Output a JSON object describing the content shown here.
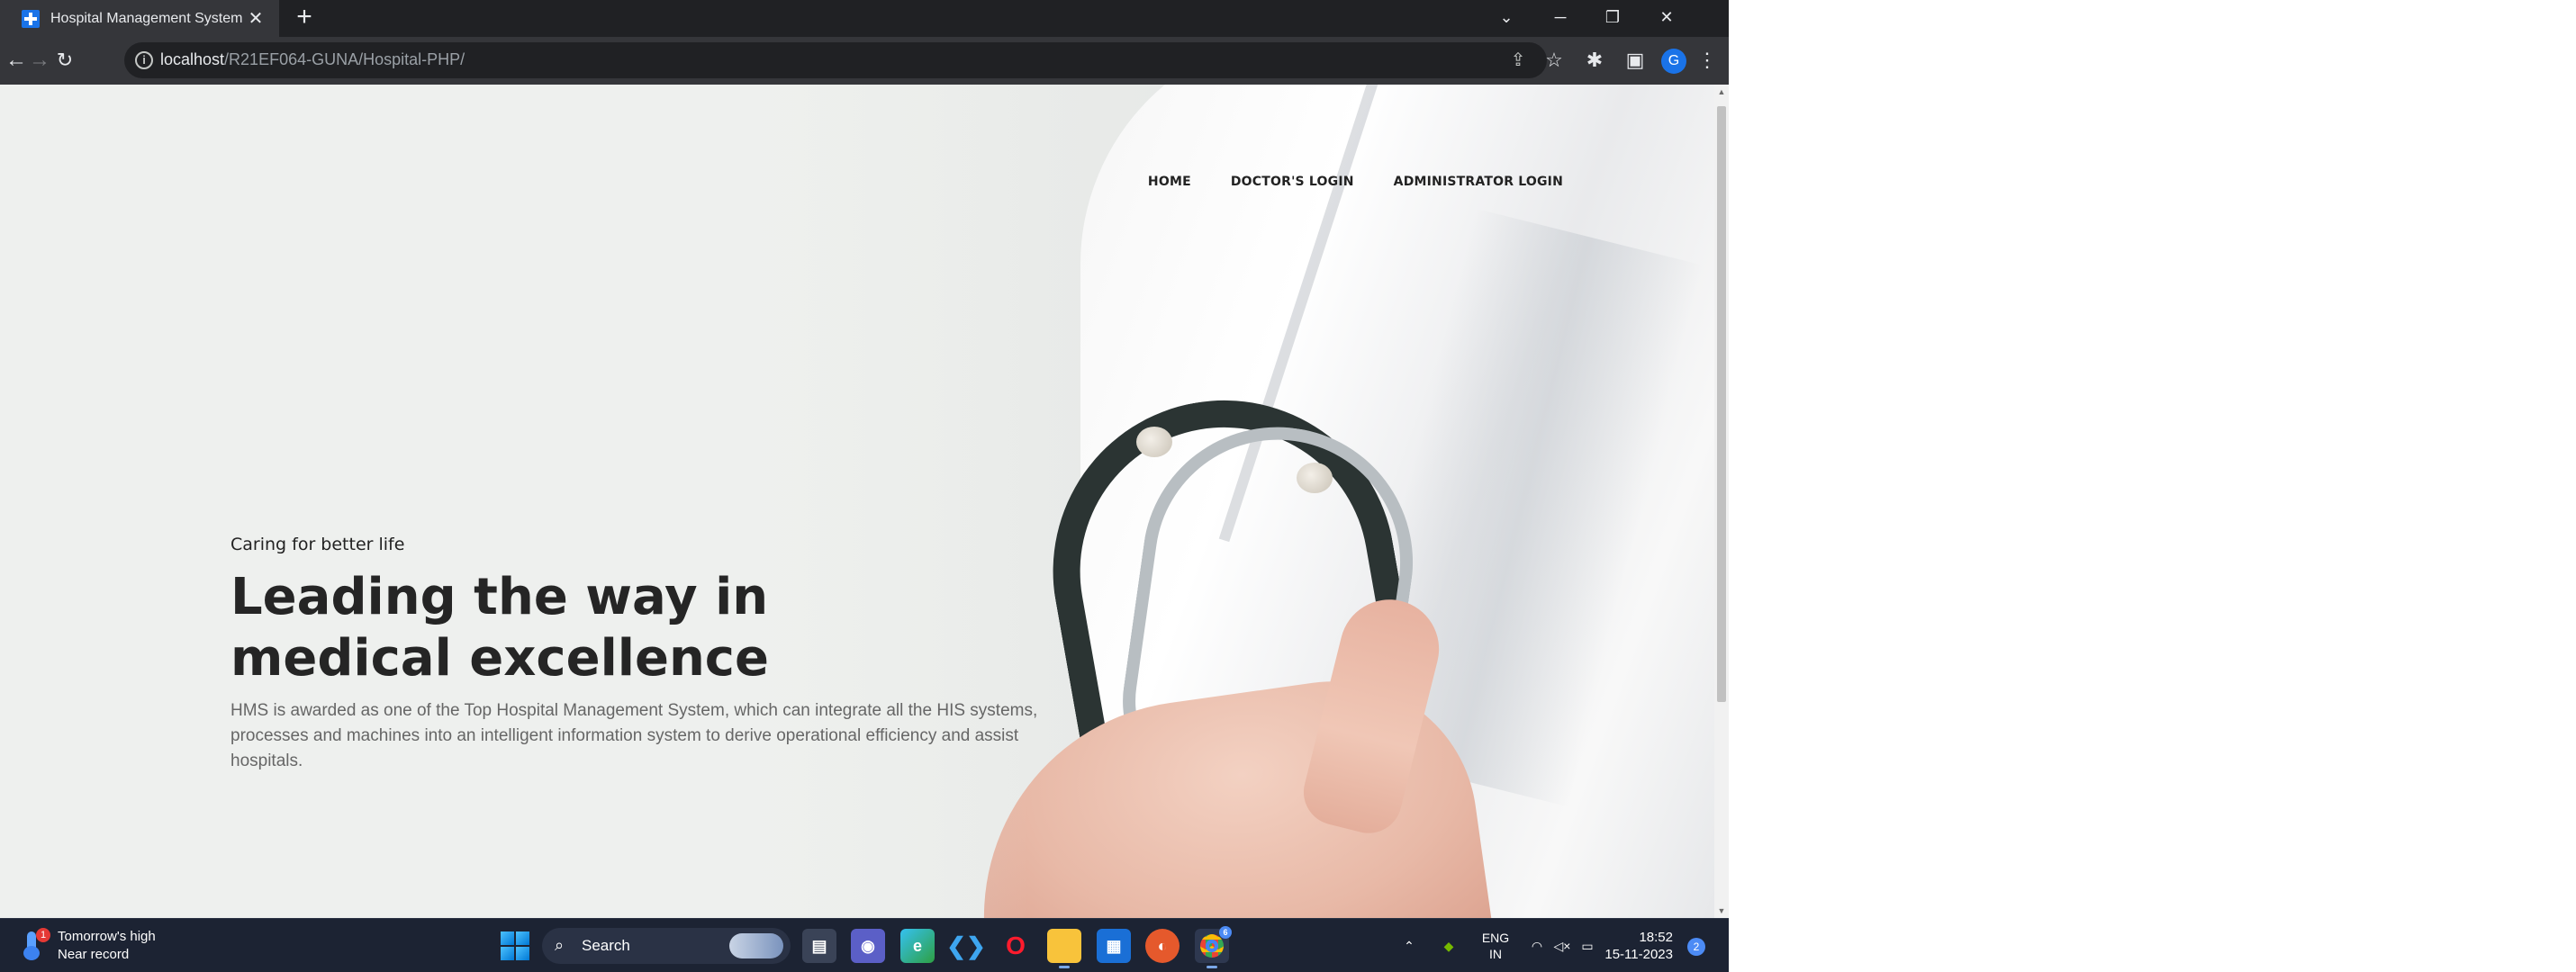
{
  "browser": {
    "tab": {
      "title": "Hospital Management System",
      "favicon": "hospital-cross-icon"
    },
    "url": {
      "host": "localhost",
      "path": "/R21EF064-GUNA/Hospital-PHP/"
    },
    "profile_initial": "G"
  },
  "site": {
    "nav": [
      {
        "label": "HOME"
      },
      {
        "label": "DOCTOR'S LOGIN"
      },
      {
        "label": "ADMINISTRATOR LOGIN"
      }
    ],
    "hero": {
      "tagline": "Caring for better life",
      "headline": "Leading the way in medical excellence",
      "description": "HMS is awarded as one of the Top Hospital Management System, which can integrate all the HIS systems, processes and machines into an intelligent information system to derive operational efficiency and assist hospitals."
    }
  },
  "taskbar": {
    "weather": {
      "line1": "Tomorrow's high",
      "line2": "Near record",
      "badge": "1"
    },
    "search_label": "Search",
    "chrome_badge": "6",
    "language": {
      "line1": "ENG",
      "line2": "IN"
    },
    "clock": {
      "time": "18:52",
      "date": "15-11-2023"
    },
    "notification_count": "2"
  }
}
